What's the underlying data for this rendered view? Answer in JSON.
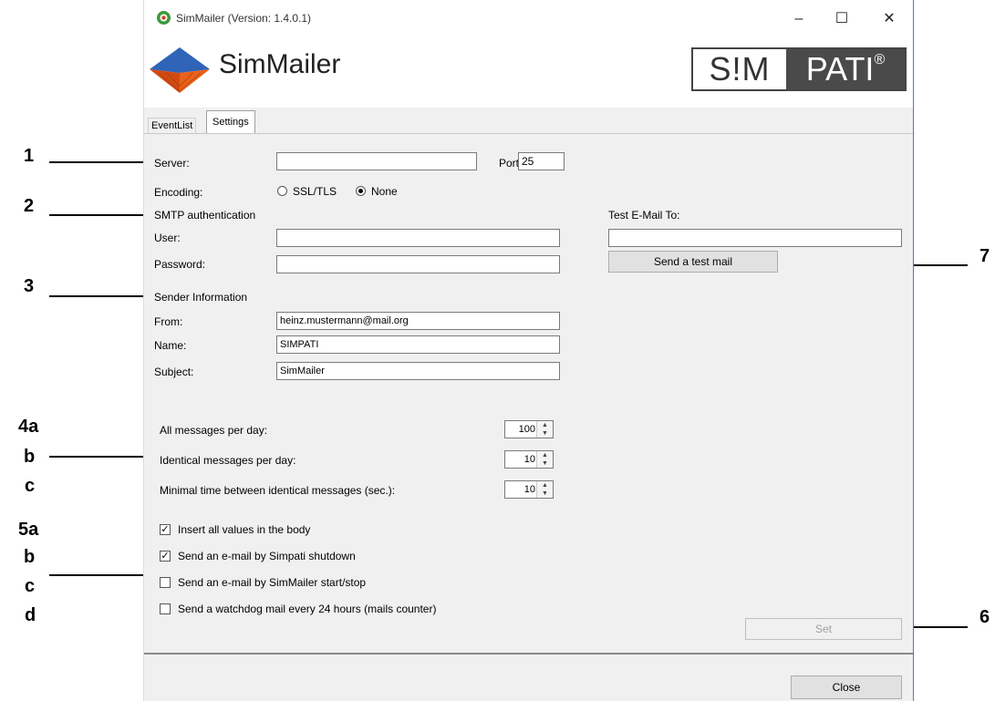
{
  "window": {
    "title": "SimMailer (Version: 1.4.0.1)",
    "controls": {
      "minimize": "–",
      "maximize": "☐",
      "close": "✕"
    }
  },
  "header": {
    "app_name": "SimMailer",
    "brand_left": "S!M",
    "brand_right": "PATI",
    "brand_reg": "®"
  },
  "tabs": [
    {
      "label": "EventList",
      "active": false
    },
    {
      "label": "Settings",
      "active": true
    }
  ],
  "server": {
    "server_label": "Server:",
    "server_value": "",
    "port_label": "Port:",
    "port_value": "25",
    "encoding_label": "Encoding:",
    "encoding_options": [
      "SSL/TLS",
      "None"
    ],
    "encoding_selected": "None"
  },
  "smtp": {
    "section_label": "SMTP authentication",
    "user_label": "User:",
    "user_value": "",
    "password_label": "Password:",
    "password_value": ""
  },
  "test_mail": {
    "label": "Test E-Mail To:",
    "value": "",
    "button": "Send a test mail"
  },
  "sender": {
    "section_label": "Sender Information",
    "from_label": "From:",
    "from_value": "heinz.mustermann@mail.org",
    "name_label": "Name:",
    "name_value": "SIMPATI",
    "subject_label": "Subject:",
    "subject_value": "SimMailer"
  },
  "limits": [
    {
      "label": "All messages per day:",
      "value": "100"
    },
    {
      "label": "Identical messages per day:",
      "value": "10"
    },
    {
      "label": "Minimal time between identical messages (sec.):",
      "value": "10"
    }
  ],
  "options": [
    {
      "label": "Insert all values in the body",
      "checked": true
    },
    {
      "label": "Send an e-mail by Simpati shutdown",
      "checked": true
    },
    {
      "label": "Send an e-mail by SimMailer start/stop",
      "checked": false
    },
    {
      "label": "Send a watchdog mail every 24 hours (mails counter)",
      "checked": false
    }
  ],
  "buttons": {
    "set": "Set",
    "close": "Close"
  },
  "annotations": {
    "n1": "1",
    "n2": "2",
    "n3": "3",
    "n4a": "4a",
    "n4b": "b",
    "n4c": "c",
    "n5a": "5a",
    "n5b": "b",
    "n5c": "c",
    "n5d": "d",
    "n6": "6",
    "n7": "7"
  },
  "colors": {
    "window_border": "#3c7fd0",
    "panel_bg": "#f0f0f0",
    "brand_dark": "#4a4a4a"
  }
}
